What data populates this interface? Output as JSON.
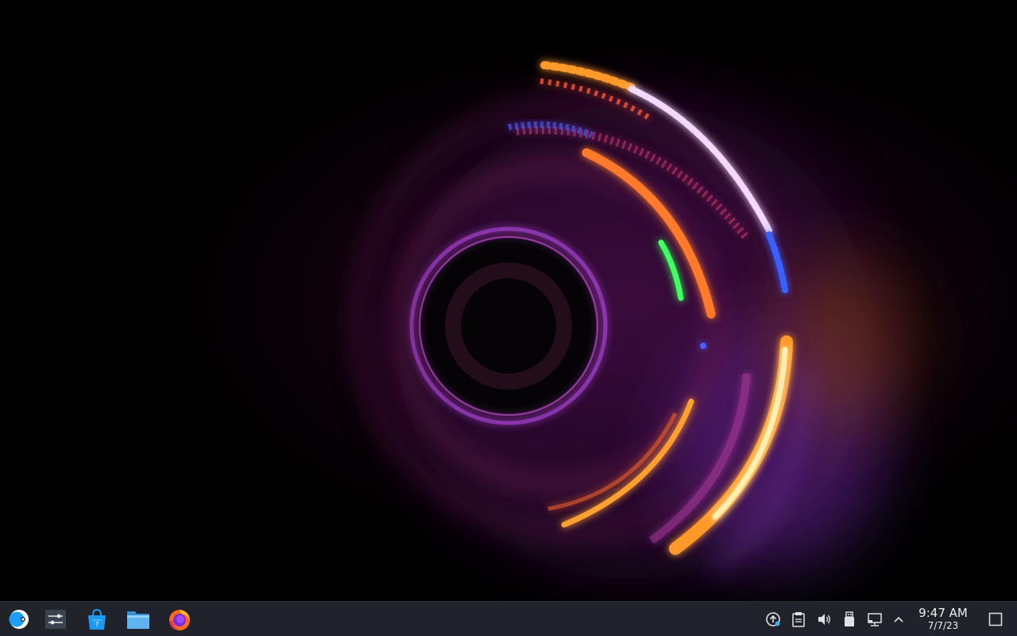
{
  "wallpaper": {
    "subject": "light-trail-rings",
    "colors": {
      "background": "#000000",
      "orange": "#ff9a2a",
      "yellow": "#ffe9a0",
      "magenta": "#c040c0",
      "purple": "#7a30d0",
      "blue": "#3a60ff",
      "green": "#40ff60",
      "white": "#f4e8ff"
    }
  },
  "taskbar": {
    "background": "#20242a",
    "launchers": [
      {
        "icon": "steam-icon"
      },
      {
        "icon": "system-settings-icon"
      },
      {
        "icon": "discover-store-icon"
      },
      {
        "icon": "dolphin-file-manager-icon"
      },
      {
        "icon": "firefox-icon"
      }
    ],
    "tray": [
      {
        "icon": "update-notification-icon"
      },
      {
        "icon": "clipboard-icon"
      },
      {
        "icon": "volume-icon"
      },
      {
        "icon": "usb-device-icon"
      },
      {
        "icon": "network-wired-icon"
      },
      {
        "icon": "chevron-up-icon"
      }
    ],
    "clock": {
      "time": "9:47 AM",
      "date": "7/7/23"
    },
    "show_desktop_icon": "show-desktop-icon"
  }
}
